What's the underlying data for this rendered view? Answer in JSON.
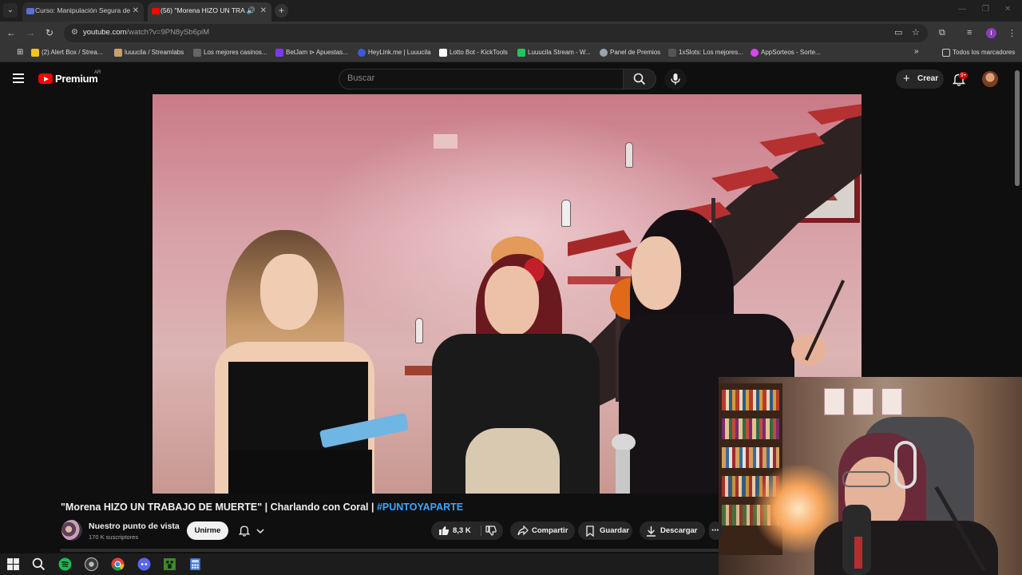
{
  "browser": {
    "tabs": [
      {
        "title": "Curso: Manipulación Segura de",
        "active": false,
        "favicon_color": "#5b6fd6"
      },
      {
        "title": "(56) \"Morena HIZO UN TRA",
        "active": true,
        "favicon_color": "#ff0000"
      }
    ],
    "url_domain": "youtube.com",
    "url_path": "/watch?v=9PN8ySb6piM",
    "bookmarks": [
      {
        "label": "(2) Alert Box / Strea...",
        "color": "#f0c419"
      },
      {
        "label": "luuucila / Streamlabs",
        "color": "#c8a06a"
      },
      {
        "label": "Los mejores casinos...",
        "color": "#666666"
      },
      {
        "label": "BetJam ⊳ Apuestas...",
        "color": "#7c3aed"
      },
      {
        "label": "HeyLink.me | Luuucila",
        "color": "#3b5bdb"
      },
      {
        "label": "Lotto Bot - KickTools",
        "color": "#ffffff"
      },
      {
        "label": "Luuucila Stream - W...",
        "color": "#22c55e"
      },
      {
        "label": "Panel de Premios",
        "color": "#9ca3af"
      },
      {
        "label": "1xSlots: Los mejores...",
        "color": "#555555"
      },
      {
        "label": "AppSorteos - Sorte...",
        "color": "#d946ef"
      }
    ],
    "all_bookmarks": "Todos los marcadores"
  },
  "youtube": {
    "brand": "Premium",
    "country": "AR",
    "search_placeholder": "Buscar",
    "create_label": "Crear",
    "notifications_badge": "9+",
    "video_title": "\"Morena HIZO UN TRABAJO DE MUERTE\" | Charlando con Coral | ",
    "video_hashtag": "#PUNTOYAPARTE",
    "channel_name": "Nuestro punto de vista",
    "channel_subs": "170 K suscriptores",
    "join_label": "Unirme",
    "like_count": "8,3 K",
    "share_label": "Compartir",
    "save_label": "Guardar",
    "download_label": "Descargar"
  },
  "colors": {
    "yt_red": "#ff0000",
    "link_blue": "#3ea6ff",
    "bg": "#0f0f0f"
  }
}
